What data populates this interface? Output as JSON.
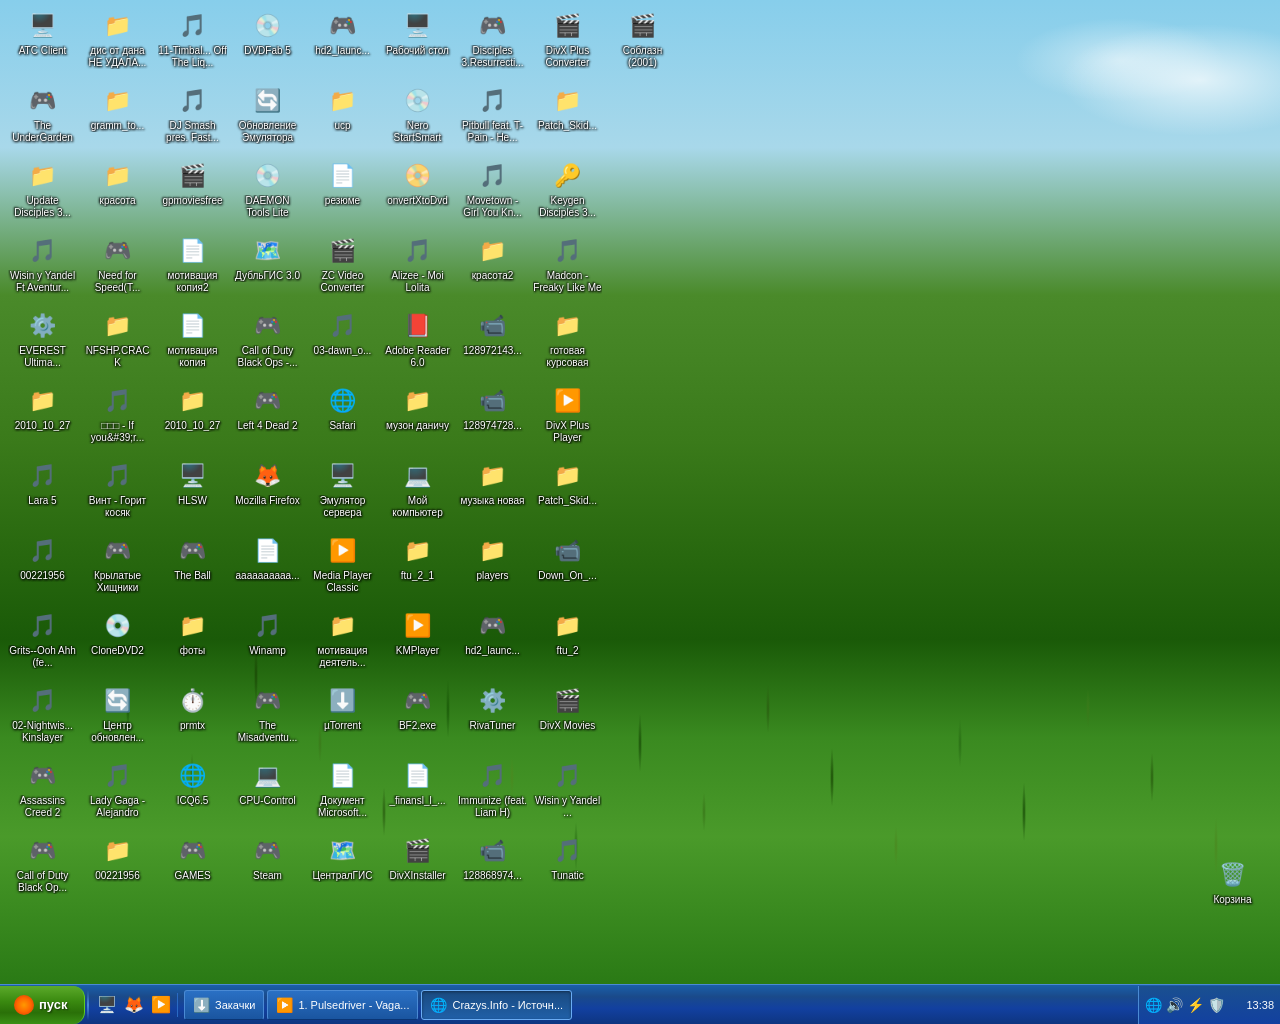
{
  "desktop": {
    "icons": [
      {
        "id": "atc-client",
        "label": "ATC Client",
        "icon": "🖥️",
        "type": "exe"
      },
      {
        "id": "the-undergarden",
        "label": "The UnderGarden",
        "icon": "🎮",
        "type": "game"
      },
      {
        "id": "update-disciples",
        "label": "Update Disciples 3...",
        "icon": "📁",
        "type": "folder"
      },
      {
        "id": "wisin-yandel",
        "label": "Wisin y Yandel Ft Aventur...",
        "icon": "🎵",
        "type": "media"
      },
      {
        "id": "everest",
        "label": "EVEREST Ultima...",
        "icon": "⚙️",
        "type": "tool"
      },
      {
        "id": "2010-10-27",
        "label": "2010_10_27",
        "icon": "📁",
        "type": "folder"
      },
      {
        "id": "lara5",
        "label": "Lara 5",
        "icon": "🎵",
        "type": "media"
      },
      {
        "id": "00221956",
        "label": "00221956",
        "icon": "🎵",
        "type": "media"
      },
      {
        "id": "grits-ooh",
        "label": "Grits--Ooh Ahh (fe...",
        "icon": "🎵",
        "type": "media"
      },
      {
        "id": "02-nightwis",
        "label": "02-Nightwis... Kinslayer",
        "icon": "🎵",
        "type": "media"
      },
      {
        "id": "assassins-creed",
        "label": "Assassins Creed 2",
        "icon": "🎮",
        "type": "game"
      },
      {
        "id": "call-of-duty-black-ops",
        "label": "Call of Duty Black Op...",
        "icon": "🎮",
        "type": "game"
      },
      {
        "id": "disc-dana",
        "label": "дис от дана НЕ УДАЛА...",
        "icon": "📁",
        "type": "folder"
      },
      {
        "id": "gramm-to",
        "label": "gramm_to...",
        "icon": "📁",
        "type": "folder"
      },
      {
        "id": "krasota",
        "label": "красота",
        "icon": "📁",
        "type": "folder"
      },
      {
        "id": "need-for-speed",
        "label": "Need for Speed(T...",
        "icon": "🎮",
        "type": "game"
      },
      {
        "id": "nfshp-crack",
        "label": "NFSHP.CRACK",
        "icon": "📁",
        "type": "folder"
      },
      {
        "id": "if-you",
        "label": "□□□ - If you&#39;r...",
        "icon": "🎵",
        "type": "media"
      },
      {
        "id": "vint-gorit",
        "label": "Винт - Горит косяк",
        "icon": "🎵",
        "type": "media"
      },
      {
        "id": "krylatye",
        "label": "Крылатые Хищники",
        "icon": "🎮",
        "type": "shortcut"
      },
      {
        "id": "clonedvd2",
        "label": "CloneDVD2",
        "icon": "💿",
        "type": "exe"
      },
      {
        "id": "centr-obnovl",
        "label": "Центр обновлен...",
        "icon": "🔄",
        "type": "tool"
      },
      {
        "id": "lady-gaga",
        "label": "Lady Gaga - Alejandro",
        "icon": "🎵",
        "type": "media"
      },
      {
        "id": "00221956-2",
        "label": "00221956",
        "icon": "📁",
        "type": "folder"
      },
      {
        "id": "11-timbal",
        "label": "11-Timbal... Off The Liq...",
        "icon": "🎵",
        "type": "media"
      },
      {
        "id": "dj-smash",
        "label": "DJ Smash pres. Fast...",
        "icon": "🎵",
        "type": "media"
      },
      {
        "id": "gpmoviesfree",
        "label": "gpmoviesfree",
        "icon": "🎬",
        "type": "media"
      },
      {
        "id": "motivaciya-kopiya2",
        "label": "мотивация копия2",
        "icon": "📄",
        "type": "document"
      },
      {
        "id": "motivaciya-kopiya",
        "label": "мотивация копия",
        "icon": "📄",
        "type": "document"
      },
      {
        "id": "2010-10-27-2",
        "label": "2010_10_27",
        "icon": "📁",
        "type": "folder"
      },
      {
        "id": "hlsw",
        "label": "HLSW",
        "icon": "🖥️",
        "type": "exe"
      },
      {
        "id": "the-ball",
        "label": "The Ball",
        "icon": "🎮",
        "type": "game"
      },
      {
        "id": "foty",
        "label": "фоты",
        "icon": "📁",
        "type": "folder"
      },
      {
        "id": "prmtx",
        "label": "prmtx",
        "icon": "⏱️",
        "type": "tool"
      },
      {
        "id": "icq65",
        "label": "ICQ6.5",
        "icon": "🌐",
        "type": "exe"
      },
      {
        "id": "games",
        "label": "GAMES",
        "icon": "🎮",
        "type": "folder"
      },
      {
        "id": "dvdfab5",
        "label": "DVDFab 5",
        "icon": "💿",
        "type": "exe"
      },
      {
        "id": "obnovlenie",
        "label": "Обновление Эмулятора",
        "icon": "🔄",
        "type": "tool"
      },
      {
        "id": "daemon-tools",
        "label": "DAEMON Tools Lite",
        "icon": "💿",
        "type": "exe"
      },
      {
        "id": "dublyagis",
        "label": "ДубльГИС 3.0",
        "icon": "🗺️",
        "type": "exe"
      },
      {
        "id": "call-of-duty-black-ops2",
        "label": "Call of Duty Black Ops -...",
        "icon": "🎮",
        "type": "game"
      },
      {
        "id": "left-4-dead2",
        "label": "Left 4 Dead 2",
        "icon": "🎮",
        "type": "game"
      },
      {
        "id": "mozilla-firefox",
        "label": "Mozilla Firefox",
        "icon": "🦊",
        "type": "exe"
      },
      {
        "id": "aaaaaaaa",
        "label": "аааааааааа...",
        "icon": "📄",
        "type": "document"
      },
      {
        "id": "winamp",
        "label": "Winamp",
        "icon": "🎵",
        "type": "exe"
      },
      {
        "id": "the-misadv",
        "label": "The Misadventu...",
        "icon": "🎮",
        "type": "game"
      },
      {
        "id": "cpu-control",
        "label": "CPU-Control",
        "icon": "💻",
        "type": "exe"
      },
      {
        "id": "steam",
        "label": "Steam",
        "icon": "🎮",
        "type": "exe"
      },
      {
        "id": "hd2-launch",
        "label": "hd2_launc...",
        "icon": "🎮",
        "type": "game"
      },
      {
        "id": "ucp",
        "label": "ucp",
        "icon": "📁",
        "type": "folder"
      },
      {
        "id": "rezyume",
        "label": "резюме",
        "icon": "📄",
        "type": "document"
      },
      {
        "id": "zc-video",
        "label": "ZC Video Converter",
        "icon": "🎬",
        "type": "exe"
      },
      {
        "id": "03-dawn",
        "label": "03-dawn_o...",
        "icon": "🎵",
        "type": "media"
      },
      {
        "id": "safari",
        "label": "Safari",
        "icon": "🌐",
        "type": "exe"
      },
      {
        "id": "emulator-servera",
        "label": "Эмулятор сервера",
        "icon": "🖥️",
        "type": "exe"
      },
      {
        "id": "media-player-classic",
        "label": "Media Player Classic",
        "icon": "▶️",
        "type": "exe"
      },
      {
        "id": "motivaciya-deyat",
        "label": "мотивация деятель...",
        "icon": "📁",
        "type": "folder"
      },
      {
        "id": "utorrent",
        "label": "µTorrent",
        "icon": "⬇️",
        "type": "exe"
      },
      {
        "id": "dokument-microsoft",
        "label": "Документ Microsoft...",
        "icon": "📄",
        "type": "document"
      },
      {
        "id": "centralgis",
        "label": "ЦентралГИС",
        "icon": "🗺️",
        "type": "exe"
      },
      {
        "id": "rabochiy-stol",
        "label": "Рабочий стол",
        "icon": "🖥️",
        "type": "folder"
      },
      {
        "id": "nero-startsmart",
        "label": "Nero StartSmart",
        "icon": "💿",
        "type": "exe"
      },
      {
        "id": "onvertxtodvd",
        "label": "onvertXtoDvd",
        "icon": "📀",
        "type": "exe"
      },
      {
        "id": "alizee",
        "label": "Alizee - Moi Lolita",
        "icon": "🎵",
        "type": "media"
      },
      {
        "id": "adobe-reader",
        "label": "Adobe Reader 6.0",
        "icon": "📕",
        "type": "exe"
      },
      {
        "id": "muzon-danich",
        "label": "музон даничу",
        "icon": "📁",
        "type": "folder"
      },
      {
        "id": "moy-computer",
        "label": "Мой компьютер",
        "icon": "💻",
        "type": "exe"
      },
      {
        "id": "ftu-2-1",
        "label": "ftu_2_1",
        "icon": "📁",
        "type": "folder"
      },
      {
        "id": "kmplayer",
        "label": "KMPlayer",
        "icon": "▶️",
        "type": "exe"
      },
      {
        "id": "bf2exe",
        "label": "BF2.exe",
        "icon": "🎮",
        "type": "game"
      },
      {
        "id": "finansi",
        "label": "_finansl_l_...",
        "icon": "📄",
        "type": "document"
      },
      {
        "id": "divxinstaller",
        "label": "DivXInstaller",
        "icon": "🎬",
        "type": "exe"
      },
      {
        "id": "disciples3",
        "label": "Disciples 3.Resurrecti...",
        "icon": "🎮",
        "type": "game"
      },
      {
        "id": "pitbull",
        "label": "Pitbull feat. T-Pain - He...",
        "icon": "🎵",
        "type": "media"
      },
      {
        "id": "movetown",
        "label": "Movetown - Girl You Kn...",
        "icon": "🎵",
        "type": "media"
      },
      {
        "id": "krasota2",
        "label": "красота2",
        "icon": "📁",
        "type": "folder"
      },
      {
        "id": "128972143",
        "label": "128972143...",
        "icon": "📹",
        "type": "media"
      },
      {
        "id": "128974728",
        "label": "128974728...",
        "icon": "📹",
        "type": "media"
      },
      {
        "id": "muzyka-novaya",
        "label": "музыка новая",
        "icon": "📁",
        "type": "folder"
      },
      {
        "id": "players",
        "label": "players",
        "icon": "📁",
        "type": "folder"
      },
      {
        "id": "hd2-launch2",
        "label": "hd2_launc...",
        "icon": "🎮",
        "type": "game"
      },
      {
        "id": "rivaturner",
        "label": "RivaTuner",
        "icon": "⚙️",
        "type": "tool"
      },
      {
        "id": "immunize",
        "label": "Immunize (feat. Liam H)",
        "icon": "🎵",
        "type": "media"
      },
      {
        "id": "128868974",
        "label": "128868974...",
        "icon": "📹",
        "type": "media"
      },
      {
        "id": "divxplus-conv",
        "label": "DivX Plus Converter",
        "icon": "🎬",
        "type": "exe"
      },
      {
        "id": "patch-skid",
        "label": "Patch_Skid...",
        "icon": "📁",
        "type": "folder"
      },
      {
        "id": "keygen-disciples",
        "label": "Keygen Disciples 3...",
        "icon": "🔑",
        "type": "tool"
      },
      {
        "id": "madcon",
        "label": "Madcon - Freaky Like Me",
        "icon": "🎵",
        "type": "media"
      },
      {
        "id": "gotovaya",
        "label": "готовая курсовая",
        "icon": "📁",
        "type": "folder"
      },
      {
        "id": "divxplus-player",
        "label": "DivX Plus Player",
        "icon": "▶️",
        "type": "exe"
      },
      {
        "id": "patch-skid2",
        "label": "Patch_Skid...",
        "icon": "📁",
        "type": "folder"
      },
      {
        "id": "down-on",
        "label": "Down_On_...",
        "icon": "📹",
        "type": "media"
      },
      {
        "id": "ftu2",
        "label": "ftu_2",
        "icon": "📁",
        "type": "folder"
      },
      {
        "id": "divx-movies",
        "label": "DivX Movies",
        "icon": "🎬",
        "type": "exe"
      },
      {
        "id": "wisin-yandel2",
        "label": "Wisin y Yandel ...",
        "icon": "🎵",
        "type": "media"
      },
      {
        "id": "tunatic",
        "label": "Tunatic",
        "icon": "🎵",
        "type": "exe"
      },
      {
        "id": "soblazn",
        "label": "Соблазн (2001)",
        "icon": "🎬",
        "type": "media"
      }
    ],
    "recycle_bin": {
      "label": "Корзина",
      "icon": "🗑️"
    }
  },
  "taskbar": {
    "start_label": "пуск",
    "quick_launch": [
      {
        "id": "ql-show-desktop",
        "icon": "🖥️",
        "tooltip": "Show Desktop"
      },
      {
        "id": "ql-firefox",
        "icon": "🦊",
        "tooltip": "Firefox"
      },
      {
        "id": "ql-media",
        "icon": "▶️",
        "tooltip": "Media Player"
      }
    ],
    "items": [
      {
        "id": "task-zakachki",
        "label": "Закачки",
        "icon": "⬇️",
        "active": false
      },
      {
        "id": "task-pulsedriver",
        "label": "1. Pulsedriver - Vaga...",
        "icon": "▶️",
        "active": false
      },
      {
        "id": "task-crazys",
        "label": "Crazys.Info - Источн...",
        "icon": "🌐",
        "active": true
      }
    ],
    "tray": {
      "icons": [
        "🔊",
        "🌐",
        "⚡"
      ],
      "clock": "13:38"
    }
  }
}
